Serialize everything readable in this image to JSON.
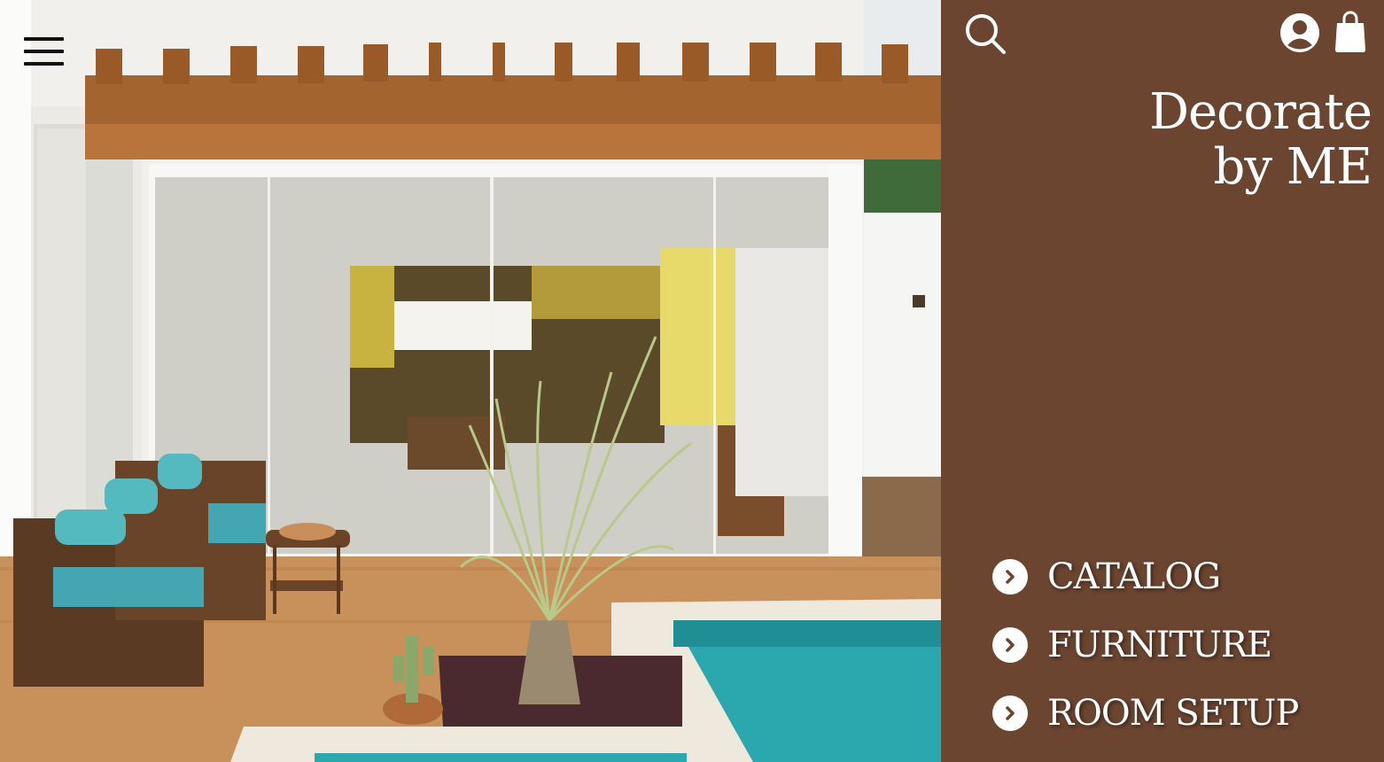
{
  "brand": {
    "line1": "Decorate",
    "line2": "by ME",
    "background_color": "#6b4530",
    "text_color": "#ffffff"
  },
  "header": {
    "menu_icon": "hamburger-menu-icon",
    "search_icon": "search-icon",
    "account_icon": "user-account-icon",
    "cart_icon": "shopping-bag-icon"
  },
  "hero": {
    "image_subject": "photo of a modern house patio with pergola, wicker sofa, glass doors and swimming pool"
  },
  "nav": {
    "items": [
      {
        "label": "CATALOG",
        "icon": "chevron-right-circle-icon"
      },
      {
        "label": "FURNITURE",
        "icon": "chevron-right-circle-icon"
      },
      {
        "label": "ROOM SETUP",
        "icon": "chevron-right-circle-icon"
      }
    ]
  }
}
